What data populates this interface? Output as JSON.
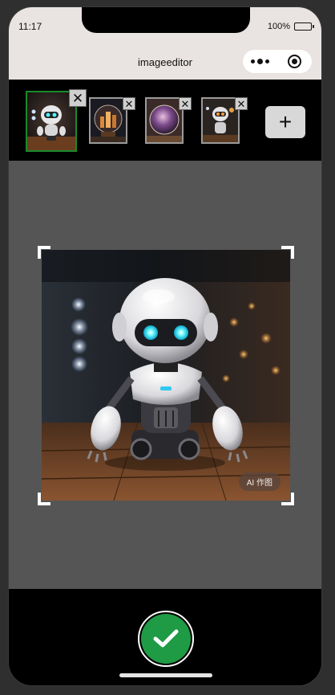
{
  "status_bar": {
    "time": "11:17",
    "battery_percent": "100%",
    "battery_level": 1.0
  },
  "nav": {
    "title": "imageeditor",
    "more_icon": "more-dots-icon",
    "close_icon": "target-circle-icon"
  },
  "thumbnails": [
    {
      "label": "robot",
      "selected": true
    },
    {
      "label": "crystal-ball-city",
      "selected": false
    },
    {
      "label": "crystal-ball-nebula",
      "selected": false
    },
    {
      "label": "robot-warm",
      "selected": false
    }
  ],
  "add_button": "+",
  "thumb_close_glyph": "✕",
  "image": {
    "badge": "AI 作图"
  },
  "confirm_icon": "checkmark-icon",
  "colors": {
    "accent_green": "#1f9a45",
    "selected_border": "#1a8a2a",
    "canvas_bg": "#555555",
    "header_bg": "#e9e3e1"
  }
}
